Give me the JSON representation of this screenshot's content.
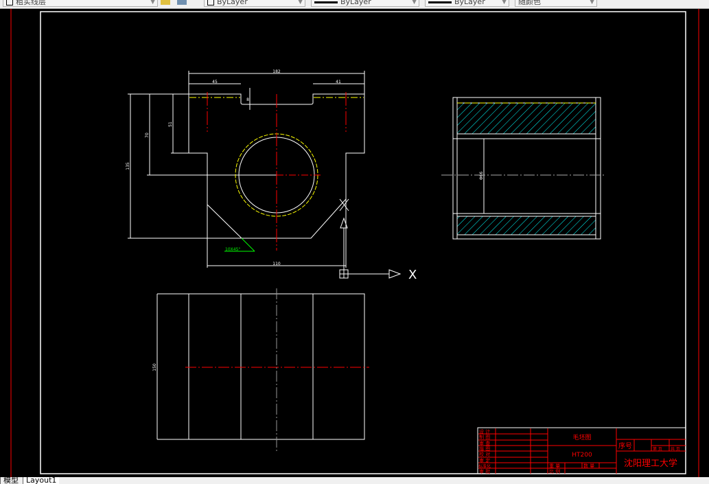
{
  "toolbar": {
    "layer": "粗实线层",
    "color": "ByLayer",
    "linetype": "ByLayer",
    "lineweight": "ByLayer",
    "plotstyle": "随颜色"
  },
  "drawing": {
    "dims": {
      "top_width": "182",
      "top_left": "45",
      "top_right": "41",
      "slot_depth": "8",
      "dim_51": "51",
      "dim_70": "70",
      "height": "135",
      "base_width": "110",
      "chamfer": "10X45°",
      "side_bore": "Φ66",
      "bottom_height": "150"
    },
    "ucs": {
      "x_label": "X"
    }
  },
  "title_block": {
    "rows": [
      "设 计",
      "制 图",
      "审 查",
      "描 图",
      "校 对",
      "审 定",
      "标准化",
      "审 批"
    ],
    "part_name": "毛坯图",
    "material": "HT200",
    "weight_label": "重 量",
    "quantity_label": "数 量",
    "scale_label": "比 例",
    "serial_label": "序号",
    "page_label": "第 页",
    "total_label": "共 页",
    "school": "沈阳理工大学"
  },
  "tabs": [
    "模型",
    "Layout1"
  ],
  "colors": {
    "line": "#ffffff",
    "red": "#ff0000",
    "yellow": "#ffff00",
    "cyan": "#00ffff",
    "green": "#00ff00"
  }
}
